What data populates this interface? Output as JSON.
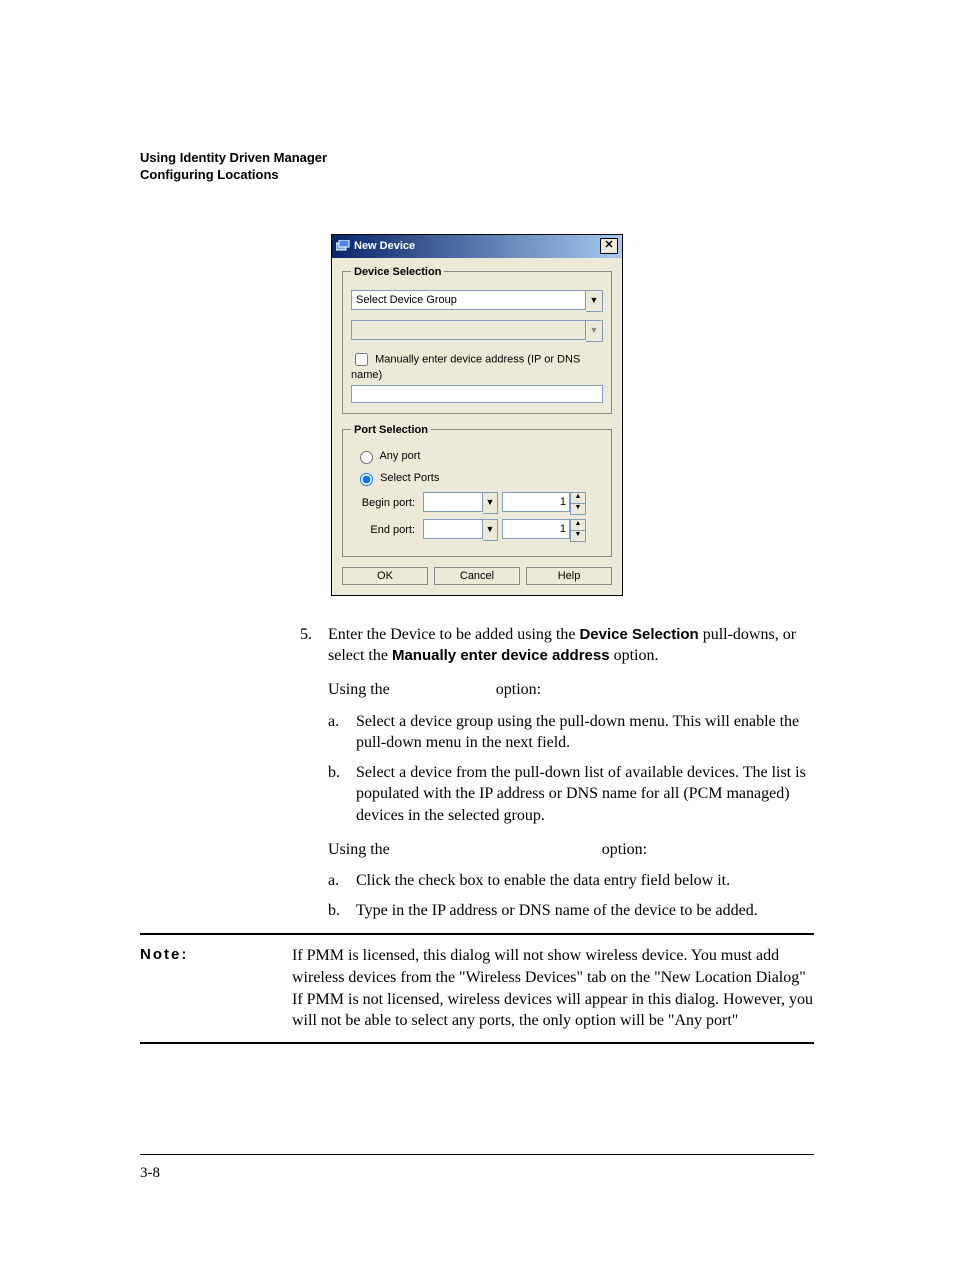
{
  "header": {
    "line1": "Using Identity Driven Manager",
    "line2": "Configuring Locations"
  },
  "dialog": {
    "title": "New Device",
    "device_selection_legend": "Device Selection",
    "select_device_group": "Select Device Group",
    "manual_checkbox_label": "Manually enter device address (IP or DNS name)",
    "port_selection_legend": "Port Selection",
    "any_port_label": "Any port",
    "select_ports_label": "Select Ports",
    "begin_port_label": "Begin port:",
    "end_port_label": "End port:",
    "begin_port_value": "1",
    "end_port_value": "1",
    "buttons": {
      "ok": "OK",
      "cancel": "Cancel",
      "help": "Help"
    }
  },
  "step5": {
    "num": "5.",
    "text_a": "Enter the Device to be added using the ",
    "bold_a": "Device Selection",
    "text_b": " pull-downs, or select the ",
    "bold_b": "Manually enter device address",
    "text_c": " option.",
    "using1_a": "Using the",
    "using1_b": "option:",
    "using2_a": "Using the",
    "using2_b": "option:",
    "sub_a_num": "a.",
    "sub_a_text": "Select a device group using the pull-down menu. This will enable the pull-down menu in the next field.",
    "sub_b_num": "b.",
    "sub_b_text": "Select a device from the pull-down list of available devices. The list is populated with the IP address or DNS name for all (PCM managed) devices in the selected group.",
    "sub2_a_num": "a.",
    "sub2_a_text": "Click the check box to enable the data entry field below it.",
    "sub2_b_num": "b.",
    "sub2_b_text": "Type in the IP address or DNS name of the device to be added."
  },
  "note": {
    "label": "Note:",
    "text": "If PMM is licensed, this dialog will not show wireless device. You must add wireless devices from the \"Wireless Devices\" tab on the \"New Location Dialog\" If PMM is not licensed, wireless devices will appear in this dialog. However, you will not be able to select any ports, the only option will be \"Any port\""
  },
  "page_number": "3-8"
}
